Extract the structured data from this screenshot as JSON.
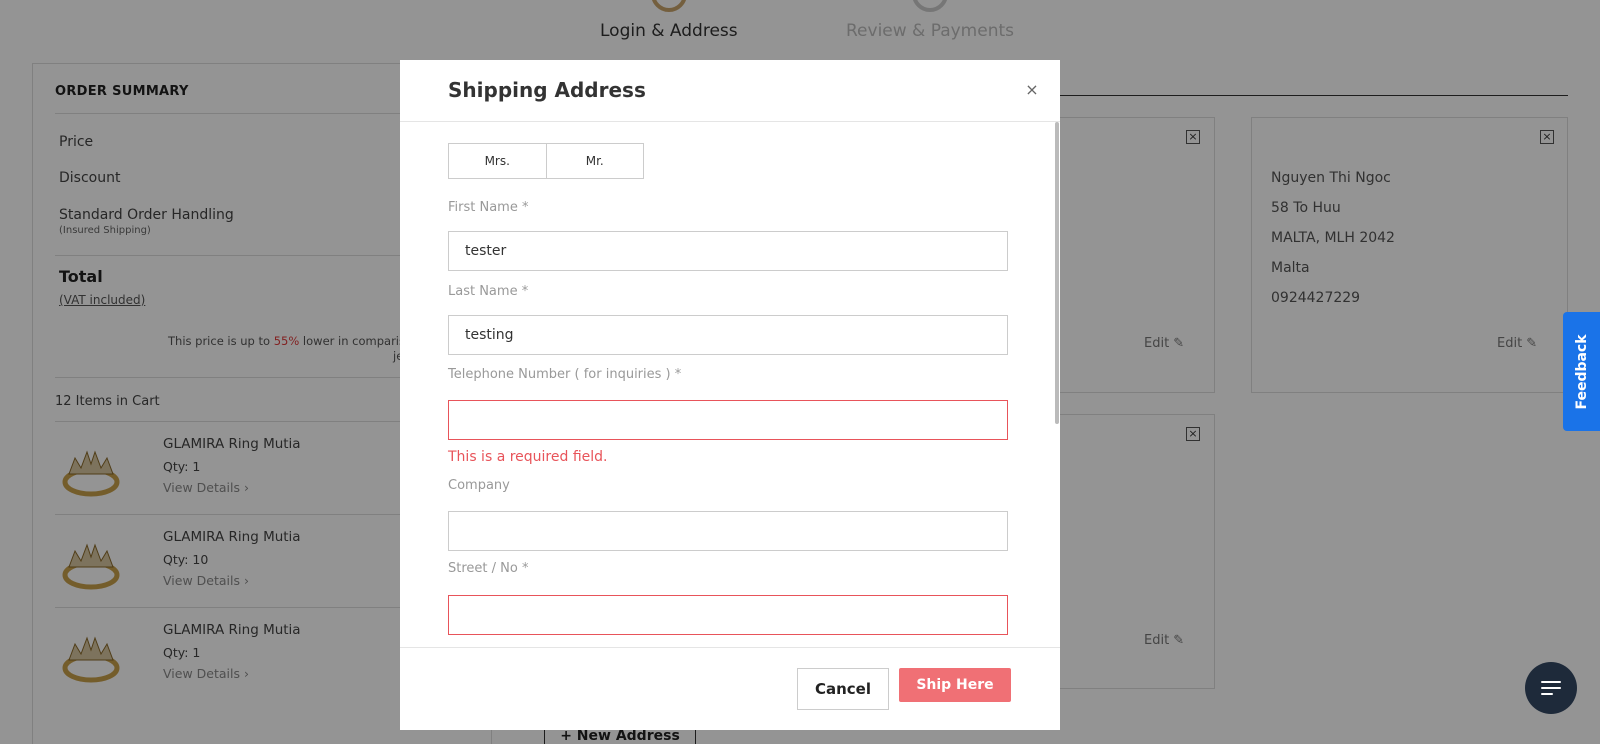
{
  "stepper": {
    "step1": "Login & Address",
    "step2": "Review & Payments"
  },
  "summary": {
    "title": "ORDER SUMMARY",
    "price_label": "Price",
    "discount_label": "Discount",
    "handling_label": "Standard Order Handling",
    "handling_note": "(Insured Shipping)",
    "total_label": "Total",
    "vat_label": "(VAT included)",
    "promo_before": "This price is up to ",
    "promo_percent": "55%",
    "promo_after": " lower in compariso",
    "promo_line2": "je",
    "items_count": "12 Items in Cart",
    "items": [
      {
        "name": "GLAMIRA Ring Mutia",
        "qty": "Qty: 1",
        "link": "View Details ›"
      },
      {
        "name": "GLAMIRA Ring Mutia",
        "qty": "Qty: 10",
        "link": "View Details ›"
      },
      {
        "name": "GLAMIRA Ring Mutia",
        "qty": "Qty: 1",
        "link": "View Details ›"
      }
    ]
  },
  "address_cards": {
    "edit_label": "Edit ✎",
    "card2": {
      "name": "Nguyen Thi Ngoc",
      "street": "58 To Huu",
      "city": "MALTA, MLH 2042",
      "country": "Malta",
      "phone": "0924427229"
    },
    "new_address": "+ New Address"
  },
  "feedback_label": "Feedback",
  "modal": {
    "title": "Shipping Address",
    "close": "×",
    "gender_options": [
      "Mrs.",
      "Mr."
    ],
    "first_name_label": "First Name *",
    "first_name_value": "tester",
    "last_name_label": "Last Name *",
    "last_name_value": "testing",
    "phone_label": "Telephone Number ( for inquiries ) *",
    "phone_value": "",
    "phone_error": "This is a required field.",
    "company_label": "Company",
    "company_value": "",
    "street_label": "Street / No  *",
    "street_value": "",
    "cancel": "Cancel",
    "ship": "Ship Here"
  },
  "colors": {
    "accent_gold": "#c9a46c",
    "error_red": "#e8545a",
    "ship_button": "#f07075",
    "feedback_blue": "#1a73e8"
  }
}
